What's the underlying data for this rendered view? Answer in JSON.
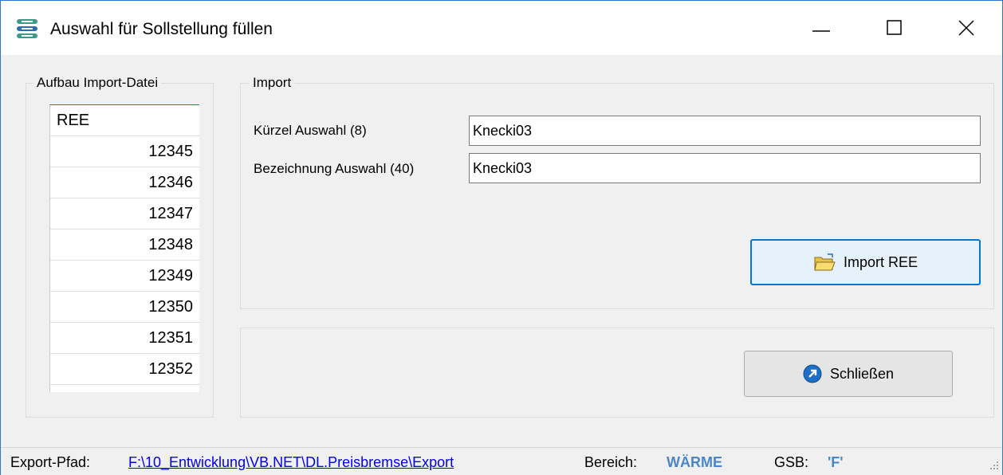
{
  "window": {
    "title": "Auswahl für Sollstellung füllen",
    "app_icon": "app-list-icon",
    "controls": [
      "minimize-icon",
      "maximize-icon",
      "close-icon"
    ]
  },
  "left_group": {
    "label": "Aufbau Import-Datei",
    "list": {
      "header": "REE",
      "rows": [
        "12345",
        "12346",
        "12347",
        "12348",
        "12349",
        "12350",
        "12351",
        "12352"
      ]
    }
  },
  "import_group": {
    "label": "Import",
    "kuerzel_label": "Kürzel Auswahl (8)",
    "kuerzel_value": "Knecki03",
    "bezeichnung_label": "Bezeichnung Auswahl (40)",
    "bezeichnung_value": "Knecki03",
    "import_button": {
      "label": "Import REE",
      "icon": "folder-open-icon"
    }
  },
  "bottom_group": {
    "close_button": {
      "label": "Schließen",
      "icon": "arrow-circle-icon"
    }
  },
  "statusbar": {
    "export_label": "Export-Pfad:",
    "export_path": "F:\\10_Entwicklung\\VB.NET\\DL.Preisbremse\\Export",
    "bereich_label": "Bereich:",
    "bereich_value": "WÄRME",
    "gsb_label": "GSB:",
    "gsb_value": "'F'"
  },
  "colors": {
    "title_border": "#2b79c9",
    "link": "#0000ee",
    "status_value": "#4a86c8",
    "focus": "#0078d7"
  }
}
